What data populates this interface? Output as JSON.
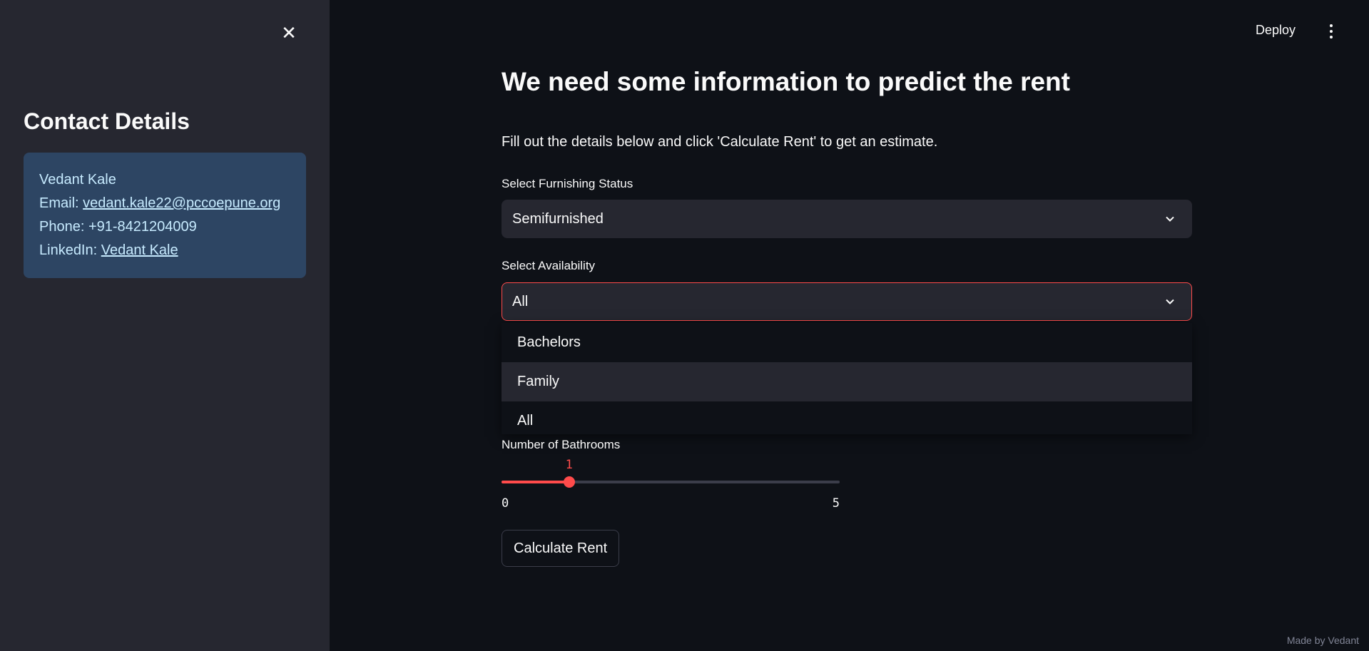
{
  "sidebar": {
    "close_icon": "close-icon",
    "title": "Contact Details",
    "contact": {
      "name": "Vedant Kale",
      "email_label": "Email: ",
      "email": "vedant.kale22@pccoepune.org",
      "phone": "Phone: +91-8421204009",
      "linkedin_label": "LinkedIn: ",
      "linkedin": "Vedant Kale"
    }
  },
  "header": {
    "deploy_label": "Deploy",
    "menu_icon": "kebab-menu-icon"
  },
  "main": {
    "title": "We need some information to predict the rent",
    "intro": "Fill out the details below and click 'Calculate Rent' to get an estimate.",
    "furnishing": {
      "label": "Select Furnishing Status",
      "value": "Semifurnished"
    },
    "availability": {
      "label": "Select Availability",
      "value": "All",
      "options": [
        "Bachelors",
        "Family",
        "All"
      ],
      "hovered": "Family"
    },
    "bathrooms": {
      "label": "Number of Bathrooms",
      "value": "1",
      "min": "0",
      "max": "5",
      "fraction": 0.2
    },
    "calculate_label": "Calculate Rent"
  },
  "footer": "Made by Vedant",
  "colors": {
    "accent": "#ff4b4b",
    "background": "#0e1117",
    "sidebar": "#262730",
    "card": "#2d4563"
  }
}
